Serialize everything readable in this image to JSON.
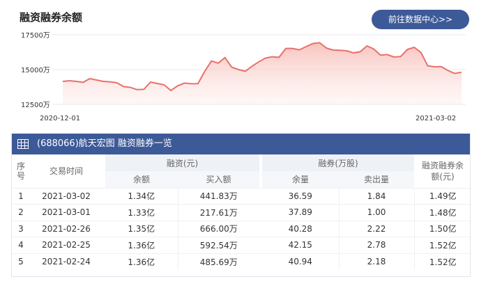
{
  "header": {
    "title": "融资融券余额",
    "button_label": "前往数据中心>>"
  },
  "chart_data": {
    "type": "area",
    "title": "融资融券余额",
    "y_ticks": [
      "17500万",
      "15000万",
      "12500万"
    ],
    "x_ticks": [
      "2020-12-01",
      "2021-03-02"
    ],
    "ylim": [
      12500,
      17500
    ],
    "values": [
      14150,
      14200,
      14150,
      14080,
      14350,
      14250,
      14150,
      14120,
      14050,
      13780,
      13720,
      13560,
      13580,
      14100,
      14000,
      13900,
      13500,
      13830,
      14030,
      13980,
      13990,
      14870,
      15620,
      15460,
      15860,
      15170,
      15000,
      14880,
      15240,
      15560,
      15830,
      15920,
      15880,
      16520,
      16520,
      16420,
      16650,
      16870,
      16930,
      16550,
      16400,
      16390,
      16350,
      16200,
      16280,
      16700,
      16480,
      16040,
      16080,
      15900,
      15940,
      16450,
      16600,
      16230,
      15270,
      15200,
      15210,
      14930,
      14720,
      14810
    ],
    "line_color": "#e8706a",
    "fill_color": "#fbd9d6"
  },
  "table": {
    "title": "(688066)航天宏图 融资融券一览",
    "headers": {
      "index": "序号",
      "date": "交易时间",
      "margin": "融资(元)",
      "securities": "融券(万股)",
      "total": "融资融券余额(元)",
      "margin_balance": "余额",
      "margin_buy": "买入额",
      "sec_balance": "余量",
      "sec_sell": "卖出量"
    },
    "rows": [
      {
        "index": "1",
        "date": "2021-03-02",
        "margin_balance": "1.34亿",
        "margin_buy": "441.83万",
        "sec_balance": "36.59",
        "sec_sell": "1.84",
        "total": "1.49亿"
      },
      {
        "index": "2",
        "date": "2021-03-01",
        "margin_balance": "1.33亿",
        "margin_buy": "217.61万",
        "sec_balance": "37.89",
        "sec_sell": "1.00",
        "total": "1.48亿"
      },
      {
        "index": "3",
        "date": "2021-02-26",
        "margin_balance": "1.35亿",
        "margin_buy": "666.00万",
        "sec_balance": "40.28",
        "sec_sell": "2.22",
        "total": "1.50亿"
      },
      {
        "index": "4",
        "date": "2021-02-25",
        "margin_balance": "1.36亿",
        "margin_buy": "592.54万",
        "sec_balance": "42.15",
        "sec_sell": "2.78",
        "total": "1.52亿"
      },
      {
        "index": "5",
        "date": "2021-02-24",
        "margin_balance": "1.36亿",
        "margin_buy": "485.69万",
        "sec_balance": "40.94",
        "sec_sell": "2.18",
        "total": "1.52亿"
      }
    ]
  }
}
